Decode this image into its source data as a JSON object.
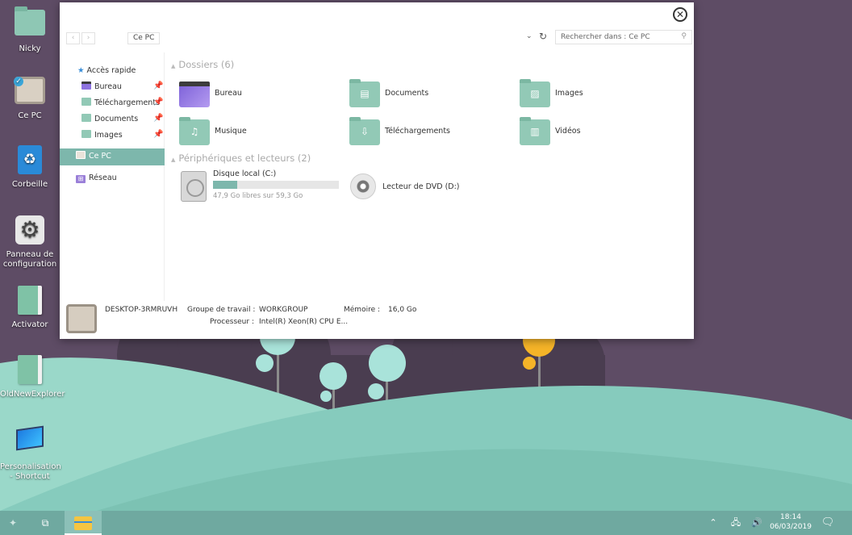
{
  "desktop": {
    "icons": [
      {
        "label": "Nicky",
        "icon": "folder-icon"
      },
      {
        "label": "Ce PC",
        "icon": "computer-icon"
      },
      {
        "label": "Corbeille",
        "icon": "recycle-bin-icon"
      },
      {
        "label": "Panneau de configuration",
        "icon": "control-panel-icon"
      },
      {
        "label": "Activator",
        "icon": "book-icon"
      },
      {
        "label": "OldNewExplorer",
        "icon": "book-icon"
      },
      {
        "label": "Personalisation - Shortcut",
        "icon": "monitor-icon"
      }
    ]
  },
  "window": {
    "close_glyph": "✕",
    "back_glyph": "‹",
    "forward_glyph": "›",
    "breadcrumb": "Ce PC",
    "dropdown_glyph": "⌄",
    "refresh_glyph": "↻",
    "search_placeholder": "Rechercher dans : Ce PC",
    "search_glyph": "⚲"
  },
  "nav": {
    "quick_access": "Accès rapide",
    "items": [
      {
        "label": "Bureau",
        "pinned": true
      },
      {
        "label": "Téléchargements",
        "pinned": true
      },
      {
        "label": "Documents",
        "pinned": true
      },
      {
        "label": "Images",
        "pinned": true
      }
    ],
    "this_pc": "Ce PC",
    "network": "Réseau",
    "pin_glyph": "📌",
    "star_glyph": "★",
    "network_glyph": "⊞"
  },
  "content": {
    "folders_header": "Dossiers (6)",
    "folders": [
      {
        "label": "Bureau",
        "glyph": ""
      },
      {
        "label": "Documents",
        "glyph": "▤"
      },
      {
        "label": "Images",
        "glyph": "▨"
      },
      {
        "label": "Musique",
        "glyph": "♫"
      },
      {
        "label": "Téléchargements",
        "glyph": "⇩"
      },
      {
        "label": "Vidéos",
        "glyph": "▥"
      }
    ],
    "devices_header": "Périphériques et lecteurs (2)",
    "drive_c": {
      "name": "Disque local (C:)",
      "free_text": "47,9 Go libres sur 59,3 Go",
      "used_fraction": 0.19
    },
    "drive_d": {
      "name": "Lecteur de DVD (D:)"
    },
    "chevron_glyph": "▲"
  },
  "details": {
    "computer_name": "DESKTOP-3RMRUVH",
    "workgroup_label": "Groupe de travail :",
    "workgroup_value": "WORKGROUP",
    "memory_label": "Mémoire :",
    "memory_value": "16,0 Go",
    "processor_label": "Processeur :",
    "processor_value": "Intel(R) Xeon(R) CPU E..."
  },
  "taskbar": {
    "start_glyph": "✦",
    "taskview_glyph": "⧉",
    "chevron_glyph": "⌃",
    "network_glyph": "🖧",
    "volume_glyph": "🔊",
    "time": "18:14",
    "date": "06/03/2019",
    "notif_glyph": "🗨"
  },
  "colors": {
    "accent": "#7db7ac",
    "taskbar": "#6fa9a0",
    "wallpaper_bg": "#5e4c65",
    "hill": "#86cbbd"
  }
}
